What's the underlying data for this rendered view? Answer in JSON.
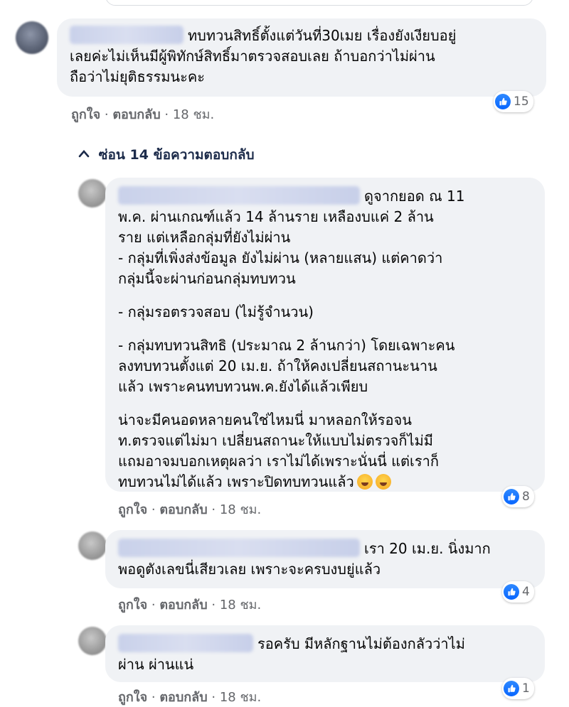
{
  "comments": [
    {
      "lines": [
        "ทบทวนสิทธิ์ตั้งแต่วันที่30เมย เรื่องยังเงียบอยู่",
        "เลยค่ะไม่เห็นมีผู้พิทักษ์สิทธิ์มาตรวจสอบเลย ถ้าบอกว่าไม่ผ่าน",
        "ถือว่าไม่ยุติธรรมนะคะ"
      ],
      "like_label": "ถูกใจ",
      "reply_label": "ตอบกลับ",
      "time": "18 ชม.",
      "reaction_count": "15"
    }
  ],
  "hide_replies_label": "ซ่อน 14 ข้อความตอบกลับ",
  "replies": [
    {
      "lines": [
        "ดูจากยอด ณ 11",
        "พ.ค. ผ่านเกณฑ์แล้ว 14 ล้านราย เหลืองบแค่ 2 ล้าน",
        "ราย แต่เหลือกลุ่มที่ยังไม่ผ่าน",
        "- กลุ่มที่เพิ่งส่งข้อมูล ยังไม่ผ่าน (หลายแสน) แต่คาดว่า",
        "กลุ่มนี้จะผ่านก่อนกลุ่มทบทวน",
        "- กลุ่มรอตรวจสอบ (ไม่รู้จำนวน)",
        "- กลุ่มทบทวนสิทธิ (ประมาณ 2 ล้านกว่า) โดยเฉพาะคน",
        "ลงทบทวนตั้งแต่ 20 เม.ย. ถ้าให้คงเปลี่ยนสถานะนาน",
        "แล้ว เพราะคนทบทวนพ.ค.ยังได้แล้วเพียบ",
        "น่าจะมีคนอดหลายคนใช่ไหมนี่ มาหลอกให้รอจน",
        "ท.ตรวจแต่ไม่มา เปลี่ยนสถานะให้แบบไม่ตรวจก็ไม่มี",
        "แถมอาจมบอกเหตุผลว่า เราไม่ได้เพราะนั่นนี่ แต่เราก็",
        "ทบทวนไม่ได้แล้ว เพราะปิดทบทวนแล้ว"
      ],
      "like_label": "ถูกใจ",
      "reply_label": "ตอบกลับ",
      "time": "18 ชม.",
      "reaction_count": "8"
    },
    {
      "lines": [
        "เรา 20 เม.ย. นิ่งมาก",
        "พอดูตังเลขนี่เสียวเลย เพราะจะครบงบยู่แล้ว"
      ],
      "like_label": "ถูกใจ",
      "reply_label": "ตอบกลับ",
      "time": "18 ชม.",
      "reaction_count": "4"
    },
    {
      "lines": [
        "รอครับ มีหลักฐานไม่ต้องกลัวว่าไม่",
        "ผ่าน ผ่านแน่"
      ],
      "like_label": "ถูกใจ",
      "reply_label": "ตอบกลับ",
      "time": "18 ชม.",
      "reaction_count": "1"
    }
  ],
  "separator": "·",
  "colors": {
    "bubble": "#f0f2f5",
    "like_blue": "#0866ff",
    "meta_text": "#65676b"
  },
  "icons": [
    "like-icon",
    "chevron-up-icon",
    "grinning-squinting-face-emoji"
  ]
}
